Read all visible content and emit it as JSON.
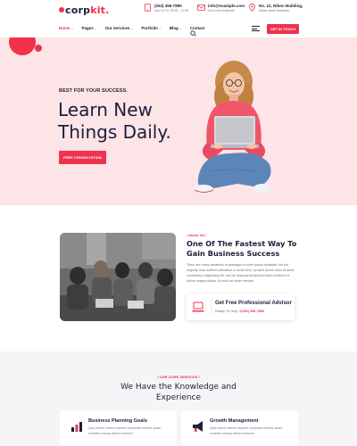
{
  "brand": {
    "name_prefix": "corp",
    "name_suffix": "kit."
  },
  "contact": {
    "phone": {
      "line1": "(252) 456-7890",
      "line2": "Mon to Fri: 09:00 - 17:00"
    },
    "email": {
      "line1": "info@example.com",
      "line2": "Get a free Estimate"
    },
    "address": {
      "line1": "No. 12, Ribon Building,",
      "line2": "Walse street Australia"
    }
  },
  "nav": {
    "items": [
      {
        "label": "Home",
        "has_dropdown": true,
        "active": true
      },
      {
        "label": "Pages",
        "has_dropdown": true
      },
      {
        "label": "Our Services",
        "has_dropdown": true
      },
      {
        "label": "Portfolio",
        "has_dropdown": true
      },
      {
        "label": "Blog",
        "has_dropdown": true
      },
      {
        "label": "Contact",
        "has_dropdown": false
      }
    ],
    "cta": "GET IN TOUCH"
  },
  "hero": {
    "kicker": "BEST FOR YOUR SUCCESS.",
    "title_line1": "Learn New",
    "title_line2": "Things Daily.",
    "button": "FREE CONSULTATION"
  },
  "about": {
    "kicker": "\\ About Us /",
    "title": "One Of The Fastest Way To Gain Business Success",
    "text": "There are many variations of passages of orem Ipsum available, but the majority have suffered alteration in some form, by ctied ipsum dolor sit amet, consectetur adipisicing elit, sed do eiusmod tempoincid idunt ut labore et dolore magna aliqua. Ut enim ad minim veniam.",
    "advisor": {
      "title": "Get Free Professional Advisor",
      "sub_prefix": "Ready To Help: ",
      "phone": "+(252) 456-7890"
    }
  },
  "services": {
    "kicker": "\\ OUR CORE SERVICES /",
    "title_line1": "We Have the Knowledge and",
    "title_line2": "Experience",
    "cards": [
      {
        "title": "Business Planning Goals",
        "text": "Quis autem veleum reprehe nderpiate velesse quam molestia unsequ atillum dolorem",
        "icon": "chart-icon"
      },
      {
        "title": "Growth Management",
        "text": "Quis autem veleum reprehe nderpiate velesse quam molestia unsequ atillum dolorem",
        "icon": "megaphone-icon"
      }
    ]
  },
  "colors": {
    "accent": "#f0324d",
    "hero_bg": "#fde4e7",
    "heading": "#1d1e3a",
    "section_bg": "#f5f5f7"
  }
}
